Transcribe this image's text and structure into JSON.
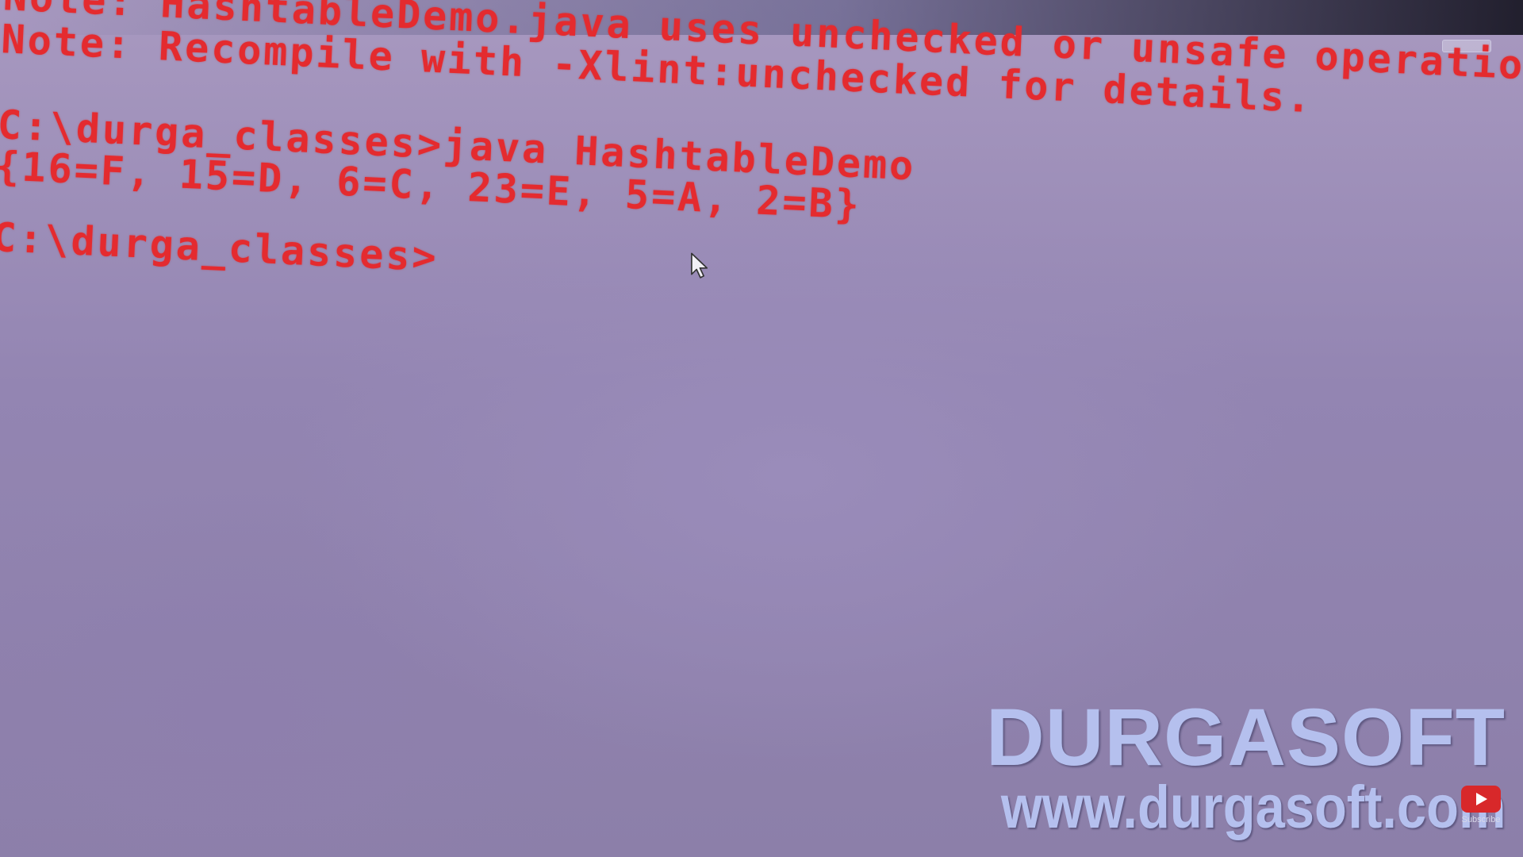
{
  "terminal": {
    "lines": [
      "Note: HashtableDemo.java uses unchecked or unsafe operations.",
      "Note: Recompile with -Xlint:unchecked for details.",
      "",
      "C:\\durga_classes>java HashtableDemo",
      "{16=F, 15=D, 6=C, 23=E, 5=A, 2=B}",
      "",
      "C:\\durga_classes>"
    ],
    "text_color": "#e42b2f",
    "background_color": "#9385b2"
  },
  "watermark": {
    "brand": "DURGASOFT",
    "url": "www.durgasoft.com",
    "color": "#b5c0ee"
  },
  "subscribe": {
    "label": "Subscribe",
    "icon": "play-icon"
  }
}
